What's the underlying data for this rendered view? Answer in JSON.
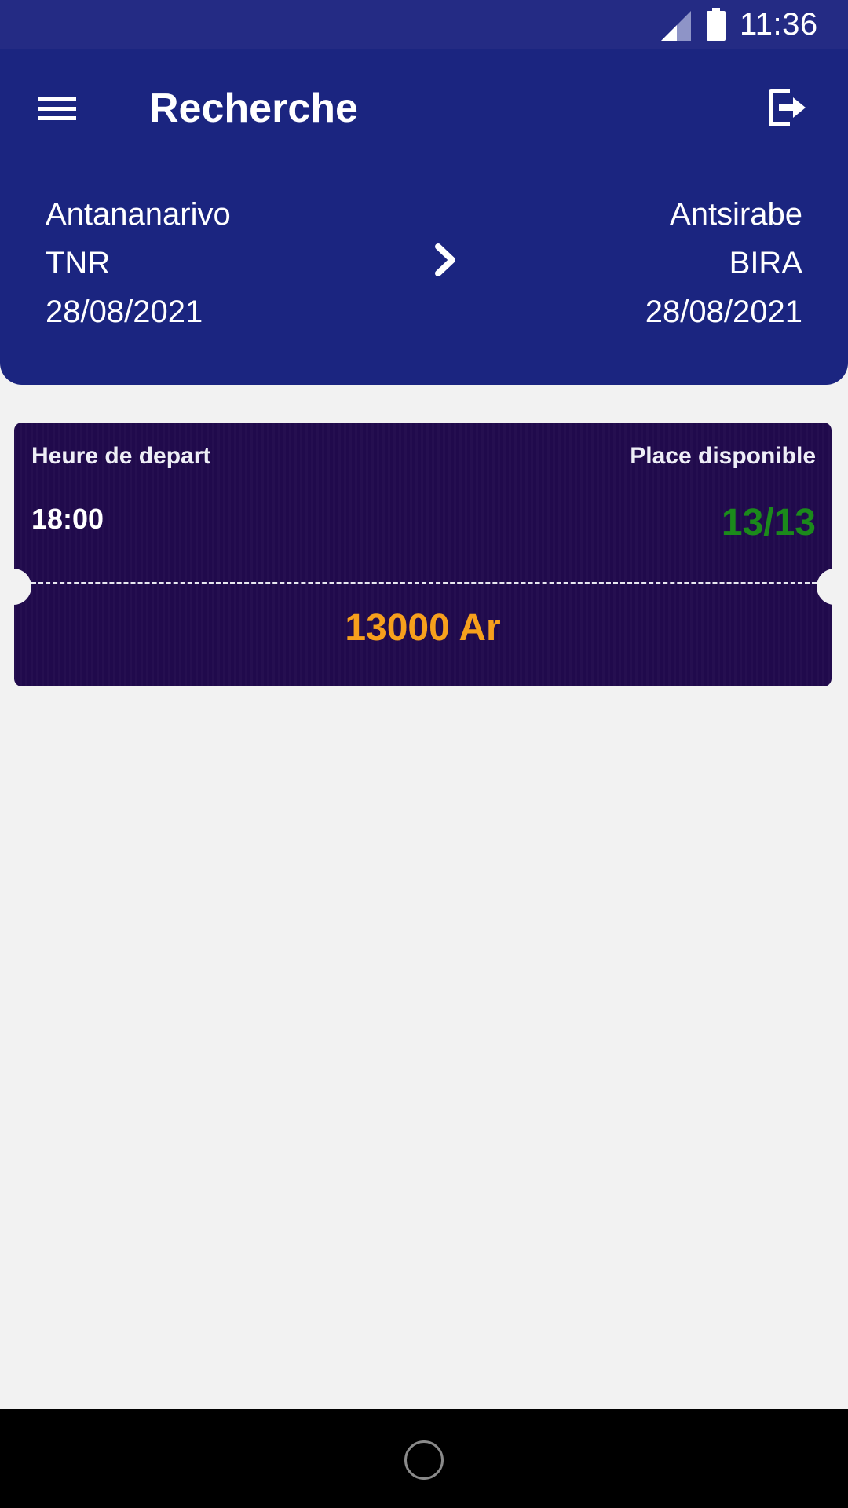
{
  "status_bar": {
    "time": "11:36",
    "icons": [
      "signal-icon",
      "battery-icon"
    ]
  },
  "header": {
    "title": "Recherche",
    "menu_icon": "hamburger-menu-icon",
    "logout_icon": "logout-icon",
    "background_color": "#1b2580"
  },
  "route": {
    "from": {
      "city": "Antananarivo",
      "code": "TNR",
      "date": "28/08/2021"
    },
    "to": {
      "city": "Antsirabe",
      "code": "BIRA",
      "date": "28/08/2021"
    },
    "arrow_icon": "chevron-right-icon"
  },
  "trips": [
    {
      "departure_label": "Heure de depart",
      "departure_time": "18:00",
      "seats_label": "Place disponible",
      "seats": "13/13",
      "price": "13000 Ar"
    }
  ],
  "colors": {
    "card": "#210a4d",
    "seats": "#1b8a1b",
    "price": "#f7a01c"
  },
  "nav_bar": {
    "home_icon": "home-circle-icon"
  }
}
